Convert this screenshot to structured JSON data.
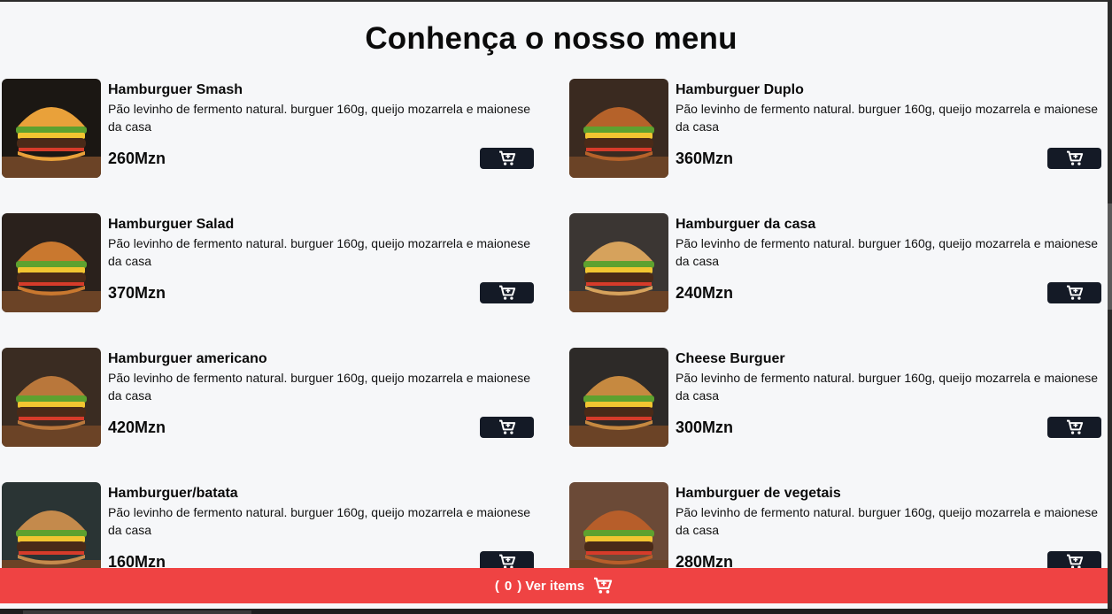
{
  "title": "Conhença o nosso menu",
  "items": [
    {
      "name": "Hamburguer Smash",
      "desc": "Pão levinho de fermento natural. burguer 160g, queijo mozarrela e maionese da casa",
      "price": "260Mzn"
    },
    {
      "name": "Hamburguer Duplo",
      "desc": "Pão levinho de fermento natural. burguer 160g, queijo mozarrela e maionese da casa",
      "price": "360Mzn"
    },
    {
      "name": "Hamburguer Salad",
      "desc": "Pão levinho de fermento natural. burguer 160g, queijo mozarrela e maionese da casa",
      "price": "370Mzn"
    },
    {
      "name": "Hamburguer da casa",
      "desc": "Pão levinho de fermento natural. burguer 160g, queijo mozarrela e maionese da casa",
      "price": "240Mzn"
    },
    {
      "name": "Hamburguer americano",
      "desc": "Pão levinho de fermento natural. burguer 160g, queijo mozarrela e maionese da casa",
      "price": "420Mzn"
    },
    {
      "name": "Cheese Burguer",
      "desc": "Pão levinho de fermento natural. burguer 160g, queijo mozarrela e maionese da casa",
      "price": "300Mzn"
    },
    {
      "name": "Hamburguer/batata",
      "desc": "Pão levinho de fermento natural. burguer 160g, queijo mozarrela e maionese da casa",
      "price": "160Mzn"
    },
    {
      "name": "Hamburguer de vegetais",
      "desc": "Pão levinho de fermento natural. burguer 160g, queijo mozarrela e maionese da casa",
      "price": "280Mzn"
    }
  ],
  "footer": {
    "open": "(",
    "count": "0",
    "close": ") Ver items"
  },
  "colors": {
    "accent": "#ef4343",
    "button": "#141a26",
    "background": "#f6f7f9"
  },
  "icons": {
    "cart": "cart-plus-icon",
    "footer_cart": "cart-icon"
  }
}
